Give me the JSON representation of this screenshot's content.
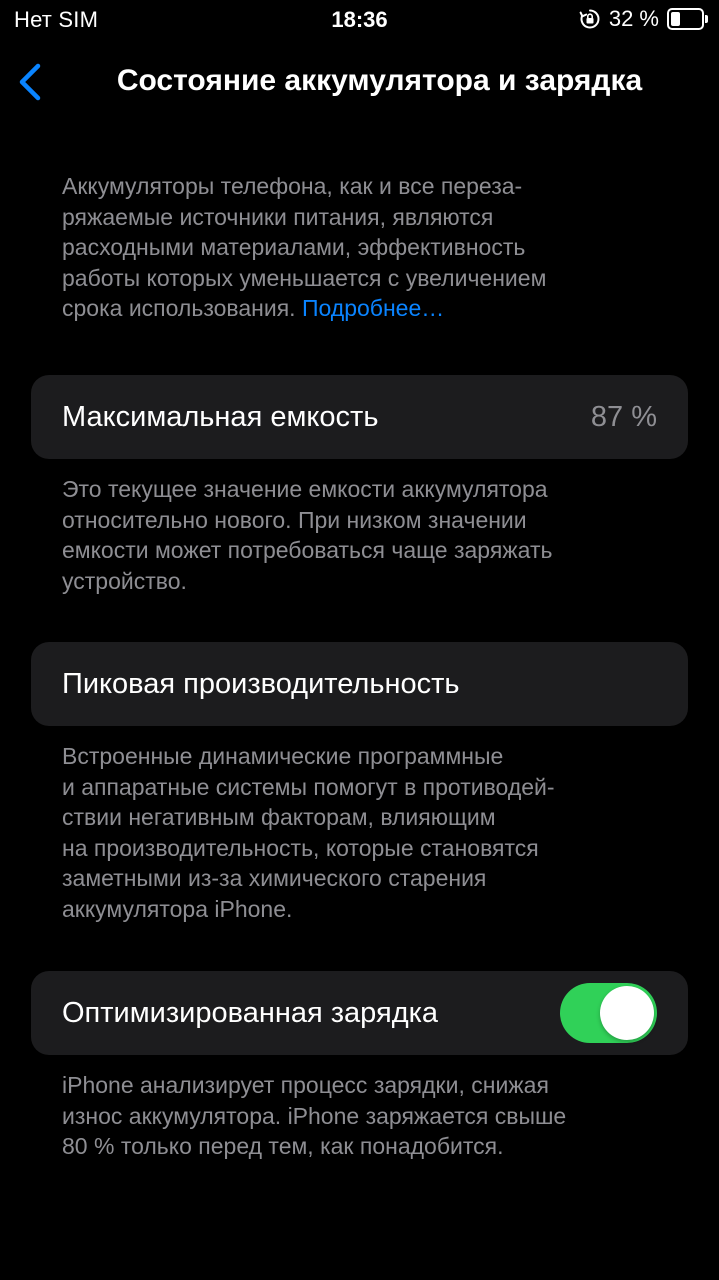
{
  "status_bar": {
    "carrier": "Нет SIM",
    "time": "18:36",
    "orientation_lock_icon": "lock-rotation-icon",
    "battery_percent": "32 %",
    "battery_level": 0.32
  },
  "nav": {
    "back_icon": "chevron-left-icon",
    "title": "Состояние аккумулятора и зарядка"
  },
  "intro": {
    "lines": [
      "Аккумуляторы телефона, как и все переза-",
      "ряжаемые источники питания, являются",
      "расходными материалами, эффективность",
      "работы которых уменьшается с увеличением"
    ],
    "last_line": "срока использования.",
    "link": "Подробнее…"
  },
  "max_capacity": {
    "label": "Максимальная емкость",
    "value": "87 %",
    "footer_lines": [
      "Это текущее значение емкости аккумулятора",
      "относительно нового. При низком значении",
      "емкости может потребоваться чаще заряжать",
      "устройство."
    ]
  },
  "peak_performance": {
    "label": "Пиковая производительность",
    "footer_lines": [
      "Встроенные динамические программные",
      "и аппаратные системы помогут в противодей-",
      "ствии негативным факторам, влияющим",
      "на производительность, которые становятся",
      "заметными из-за химического старения",
      "аккумулятора iPhone."
    ]
  },
  "optimized_charging": {
    "label": "Оптимизированная зарядка",
    "enabled": true,
    "toggle_color": "#30d158",
    "footer_lines": [
      "iPhone анализирует процесс зарядки, снижая",
      "износ аккумулятора. iPhone заряжается свыше",
      "80 % только перед тем, как понадобится."
    ]
  },
  "colors": {
    "background": "#000000",
    "cell_background": "#1c1c1e",
    "secondary_text": "#8e8e93",
    "link": "#0a84ff",
    "accent_green": "#30d158"
  }
}
